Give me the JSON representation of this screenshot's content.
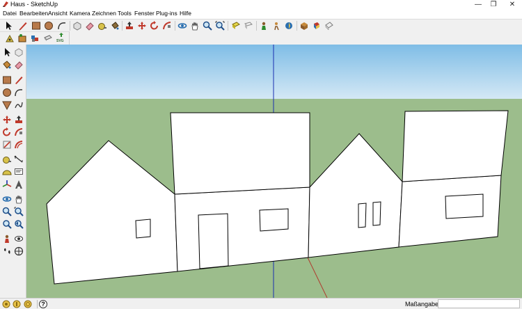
{
  "window": {
    "title": "Haus - SketchUp",
    "minimize": "—",
    "restore": "❐",
    "close": "✕"
  },
  "menu": {
    "items": [
      {
        "label": "Datei"
      },
      {
        "label": "Bearbeiten"
      },
      {
        "label": "Ansicht"
      },
      {
        "label": "Kamera"
      },
      {
        "label": "Zeichnen"
      },
      {
        "label": "Tools"
      },
      {
        "label": "Fenster"
      },
      {
        "label": "Plug-ins"
      },
      {
        "label": "Hilfe"
      }
    ]
  },
  "toolbar2": {
    "svg_label": "SVG"
  },
  "statusbar": {
    "measurements_label": "Maßangaben",
    "measurements_value": "",
    "help_icon_glyph": "?"
  },
  "colors": {
    "sky_top": "#7fbde6",
    "sky_bottom": "#cfe6f4",
    "ground": "#9cbd8c",
    "blue_axis": "#1a2fb0",
    "red_axis": "#b03a2e",
    "green_axis": "#2e8b2e",
    "building_face": "#ffffff",
    "edge": "#000000"
  }
}
